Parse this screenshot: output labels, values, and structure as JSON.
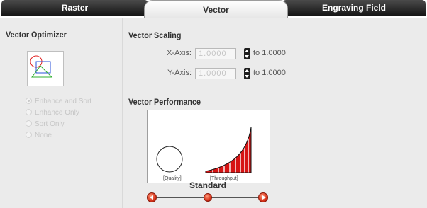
{
  "tabs": {
    "raster": "Raster",
    "vector": "Vector",
    "engraving": "Engraving Field",
    "active": "Vector"
  },
  "optimizer": {
    "title": "Vector Optimizer",
    "options": [
      "Enhance and Sort",
      "Enhance Only",
      "Sort Only",
      "None"
    ],
    "selected": "Enhance and Sort",
    "enabled": false
  },
  "scaling": {
    "title": "Vector Scaling",
    "x_label": "X-Axis:",
    "x_value": "1.0000",
    "x_suffix": "to 1.0000",
    "y_label": "Y-Axis:",
    "y_value": "1.0000",
    "y_suffix": "to 1.0000"
  },
  "performance": {
    "title": "Vector Performance",
    "quality_caption": "[Quality]",
    "throughput_caption": "[Throughput]",
    "level": "Standard"
  },
  "colors": {
    "accent_red": "#d8321a",
    "tab_dark": "#1e1e1e",
    "panel_bg": "#ebebeb"
  },
  "icons": {
    "preview": "vector-preview-icon",
    "quality": "quality-circle-icon",
    "throughput": "throughput-bars-icon",
    "decrease": "arrow-left-icon",
    "increase": "arrow-right-icon"
  }
}
